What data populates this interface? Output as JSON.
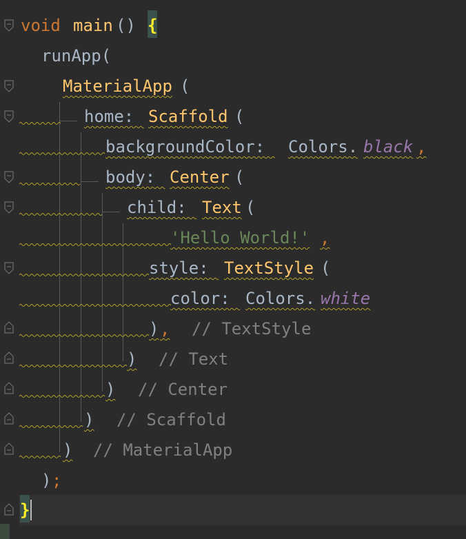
{
  "editor": {
    "language": "Dart",
    "colors": {
      "background": "#2b2b2b",
      "keyword": "#cc7832",
      "function": "#ffc66d",
      "identifier": "#a9b7c6",
      "string": "#6a8759",
      "comment": "#808080",
      "static_field": "#9876aa",
      "brace_highlight": "#3b514d"
    }
  },
  "code": {
    "void_kw": "void",
    "main_fn": "main",
    "main_parens": "()",
    "open_brace": "{",
    "run_app": "runApp(",
    "material_app": "MaterialApp",
    "paren": "(",
    "home_label": "home: ",
    "scaffold": "Scaffold",
    "bg_label": "backgroundColor: ",
    "colors_cls": "Colors.",
    "black": "black",
    "comma": ",",
    "body_label": "body: ",
    "center": "Center",
    "child_label": "child: ",
    "text_cls": "Text",
    "hello": "'Hello World!'",
    "style_label": "style: ",
    "text_style": "TextStyle",
    "color_label": "color: ",
    "white": "white",
    "close_paren": ")",
    "comment_textstyle": "// TextStyle",
    "comment_text": "// Text",
    "comment_center": "// Center",
    "comment_scaffold": "// Scaffold",
    "comment_materialapp": "// MaterialApp",
    "semicolon": ";",
    "close_brace": "}"
  }
}
